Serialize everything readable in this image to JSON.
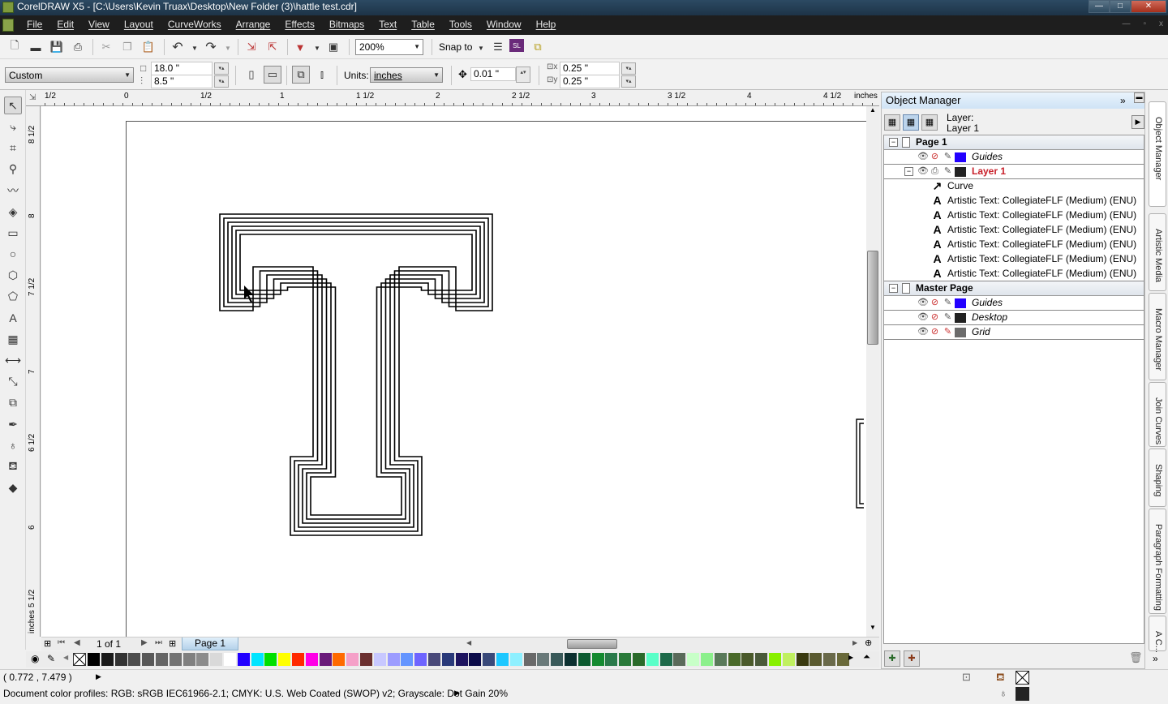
{
  "window": {
    "title": "CorelDRAW X5 - [C:\\Users\\Kevin Truax\\Desktop\\New Folder (3)\\hattle test.cdr]",
    "controls": {
      "minimize": "—",
      "restore": "□",
      "close": "✕"
    }
  },
  "menu": [
    "File",
    "Edit",
    "View",
    "Layout",
    "CurveWorks",
    "Arrange",
    "Effects",
    "Bitmaps",
    "Text",
    "Table",
    "Tools",
    "Window",
    "Help"
  ],
  "mdi_controls": {
    "minimize": "—",
    "restore": "▫",
    "close": "x"
  },
  "standard_toolbar": {
    "icons": [
      "new-icon",
      "open-icon",
      "save-icon",
      "print-icon",
      "cut-icon",
      "copy-icon",
      "paste-icon",
      "undo-icon",
      "redo-icon",
      "import-icon",
      "export-icon",
      "application-launcher-icon",
      "welcome-screen-icon"
    ],
    "zoom_level": "200%",
    "snap_to_label": "Snap to",
    "icons_right": [
      "options-icon",
      "corel-connect-icon",
      "dynamic-guides-icon"
    ]
  },
  "property_bar": {
    "page_preset": "Custom",
    "page_width": "18.0 \"",
    "page_height": "8.5 \"",
    "units_label": "Units:",
    "units_value": "inches",
    "nudge_distance": "0.01 \"",
    "duplicate_x": "0.25 \"",
    "duplicate_y": "0.25 \""
  },
  "toolbox": [
    "pick-tool",
    "shape-tool",
    "crop-tool",
    "zoom-tool",
    "freehand-tool",
    "smart-fill-tool",
    "rectangle-tool",
    "ellipse-tool",
    "polygon-tool",
    "basic-shapes-tool",
    "text-tool",
    "table-tool",
    "dimension-tool",
    "connector-tool",
    "blend-tool",
    "eyedropper-tool",
    "outline-tool",
    "fill-tool",
    "interactive-fill-tool"
  ],
  "rulers": {
    "unit_label": "inches",
    "horizontal_ticks": [
      "1/2",
      "0",
      "1/2",
      "1",
      "1 1/2",
      "2",
      "2 1/2",
      "3",
      "3 1/2",
      "4",
      "4 1/2"
    ],
    "vertical_ticks": [
      "8 1/2",
      "8",
      "7 1/2",
      "7",
      "6 1/2",
      "6",
      "5 1/2"
    ]
  },
  "page_nav": {
    "counter": "1 of 1",
    "tab": "Page 1"
  },
  "palette": {
    "colors": [
      "#000000",
      "#1a1a1a",
      "#333333",
      "#4d4d4d",
      "#595959",
      "#666666",
      "#737373",
      "#808080",
      "#8c8c8c",
      "#d9d9d9",
      "#ffffff",
      "#2200ff",
      "#00e5ff",
      "#00e000",
      "#ffff00",
      "#ff2a00",
      "#ff00e6",
      "#6a1a7a",
      "#ff6a00",
      "#f5a0c8",
      "#6b3030",
      "#c8c8ff",
      "#9c9cff",
      "#6495ff",
      "#6e64ff",
      "#4a4a7a",
      "#2a3a7a",
      "#1e1460",
      "#0c0c4a",
      "#3a4a7a",
      "#1ec8ff",
      "#8ef0ff",
      "#6a6a6a",
      "#6a7a7a",
      "#3a5a5a",
      "#0c3030",
      "#0c5a30",
      "#148a30",
      "#2a7a4a",
      "#2a7a3a",
      "#2a6a2a",
      "#5affc8",
      "#1e6a4a",
      "#5a6a5a",
      "#c8ffc8",
      "#8cf08c",
      "#5a7a5a",
      "#4a6a2a",
      "#4a5a2a",
      "#4a5a3a",
      "#88f000",
      "#c0f060",
      "#3a3a10",
      "#5a5a30",
      "#6a6a4a",
      "#6a6a3a"
    ]
  },
  "object_manager": {
    "title": "Object Manager",
    "layer_label": "Layer:",
    "layer_value": "Layer 1",
    "tree": [
      {
        "type": "page",
        "label": "Page 1"
      },
      {
        "type": "layer",
        "label": "Guides",
        "color": "#2200ff",
        "italic": true
      },
      {
        "type": "layer",
        "label": "Layer 1",
        "color": "#222222",
        "active": true
      },
      {
        "type": "object",
        "label": "Curve",
        "icon": "curve-icon"
      },
      {
        "type": "object",
        "label": "Artistic Text: CollegiateFLF (Medium) (ENU)",
        "icon": "artistic-text-icon"
      },
      {
        "type": "object",
        "label": "Artistic Text: CollegiateFLF (Medium) (ENU)",
        "icon": "artistic-text-icon"
      },
      {
        "type": "object",
        "label": "Artistic Text: CollegiateFLF (Medium) (ENU)",
        "icon": "artistic-text-icon"
      },
      {
        "type": "object",
        "label": "Artistic Text: CollegiateFLF (Medium) (ENU)",
        "icon": "artistic-text-icon"
      },
      {
        "type": "object",
        "label": "Artistic Text: CollegiateFLF (Medium) (ENU)",
        "icon": "artistic-text-icon"
      },
      {
        "type": "object",
        "label": "Artistic Text: CollegiateFLF (Medium) (ENU)",
        "icon": "artistic-text-icon"
      },
      {
        "type": "page",
        "label": "Master Page"
      },
      {
        "type": "layer",
        "label": "Guides",
        "color": "#2200ff",
        "italic": true
      },
      {
        "type": "layer",
        "label": "Desktop",
        "color": "#222222",
        "italic": true
      },
      {
        "type": "layer",
        "label": "Grid",
        "color": "#6b6b6b",
        "italic": true
      }
    ]
  },
  "dockers": [
    "Object Manager",
    "Artistic Media",
    "Macro Manager",
    "Join Curves",
    "Shaping",
    "Paragraph Formatting",
    "A C..."
  ],
  "status": {
    "cursor_position": "( 0.772 , 7.479 )",
    "color_profiles": "Document color profiles: RGB: sRGB IEC61966-2.1; CMYK: U.S. Web Coated (SWOP) v2; Grayscale: Dot Gain 20%",
    "fill_color": "none",
    "outline_color": "#222222"
  }
}
